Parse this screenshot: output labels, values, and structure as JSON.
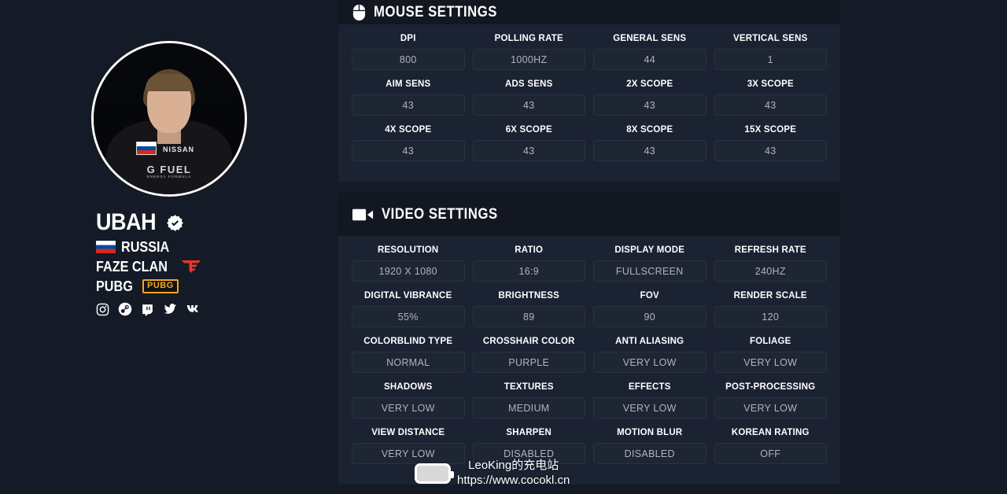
{
  "profile": {
    "name": "UBAH",
    "verified": true,
    "country": "RUSSIA",
    "team": "FAZE CLAN",
    "game": "PUBG",
    "game_badge_label": "PUBG",
    "avatar": {
      "jersey_brand": "NISSAN",
      "jersey_sponsor": "G FUEL",
      "jersey_sponsor_sub": "ENERGY FORMULA"
    },
    "socials": [
      {
        "name": "instagram-icon",
        "label": "Instagram"
      },
      {
        "name": "steam-icon",
        "label": "Steam"
      },
      {
        "name": "twitch-icon",
        "label": "Twitch"
      },
      {
        "name": "twitter-icon",
        "label": "Twitter"
      },
      {
        "name": "vk-icon",
        "label": "VK"
      }
    ]
  },
  "colors": {
    "page_bg": "#141a26",
    "panel_bg": "#1b2232",
    "panel_header_bg": "#121722",
    "input_bg": "#1e2533",
    "input_border": "#2a3244",
    "text_primary": "#ffffff",
    "text_value": "#aeb4c2",
    "faze_red": "#e8352a",
    "pubg_gold": "#f0a81e",
    "flag_blue": "#0b48a0",
    "flag_red": "#d52b1e"
  },
  "sections": [
    {
      "id": "mouse-settings",
      "title": "MOUSE SETTINGS",
      "icon": "mouse-icon",
      "fields": [
        {
          "label": "DPI",
          "value": "800"
        },
        {
          "label": "POLLING RATE",
          "value": "1000HZ"
        },
        {
          "label": "GENERAL SENS",
          "value": "44"
        },
        {
          "label": "VERTICAL SENS",
          "value": "1"
        },
        {
          "label": "AIM SENS",
          "value": "43"
        },
        {
          "label": "ADS SENS",
          "value": "43"
        },
        {
          "label": "2X SCOPE",
          "value": "43"
        },
        {
          "label": "3X SCOPE",
          "value": "43"
        },
        {
          "label": "4X SCOPE",
          "value": "43"
        },
        {
          "label": "6X SCOPE",
          "value": "43"
        },
        {
          "label": "8X SCOPE",
          "value": "43"
        },
        {
          "label": "15X SCOPE",
          "value": "43"
        }
      ]
    },
    {
      "id": "video-settings",
      "title": "VIDEO SETTINGS",
      "icon": "video-camera-icon",
      "fields": [
        {
          "label": "RESOLUTION",
          "value": "1920 X 1080"
        },
        {
          "label": "RATIO",
          "value": "16:9"
        },
        {
          "label": "DISPLAY MODE",
          "value": "FULLSCREEN"
        },
        {
          "label": "REFRESH RATE",
          "value": "240HZ"
        },
        {
          "label": "DIGITAL VIBRANCE",
          "value": "55%"
        },
        {
          "label": "BRIGHTNESS",
          "value": "89"
        },
        {
          "label": "FOV",
          "value": "90"
        },
        {
          "label": "RENDER SCALE",
          "value": "120"
        },
        {
          "label": "COLORBLIND TYPE",
          "value": "NORMAL"
        },
        {
          "label": "CROSSHAIR COLOR",
          "value": "PURPLE"
        },
        {
          "label": "ANTI ALIASING",
          "value": "VERY LOW"
        },
        {
          "label": "FOLIAGE",
          "value": "VERY LOW"
        },
        {
          "label": "SHADOWS",
          "value": "VERY LOW"
        },
        {
          "label": "TEXTURES",
          "value": "MEDIUM"
        },
        {
          "label": "EFFECTS",
          "value": "VERY LOW"
        },
        {
          "label": "POST-PROCESSING",
          "value": "VERY LOW"
        },
        {
          "label": "VIEW DISTANCE",
          "value": "VERY LOW"
        },
        {
          "label": "SHARPEN",
          "value": "DISABLED"
        },
        {
          "label": "MOTION BLUR",
          "value": "DISABLED"
        },
        {
          "label": "KOREAN RATING",
          "value": "OFF"
        }
      ]
    }
  ],
  "watermark": {
    "line1": "LeoKing的充电站",
    "line2": "https://www.cocokl.cn",
    "icon": "battery-icon"
  }
}
